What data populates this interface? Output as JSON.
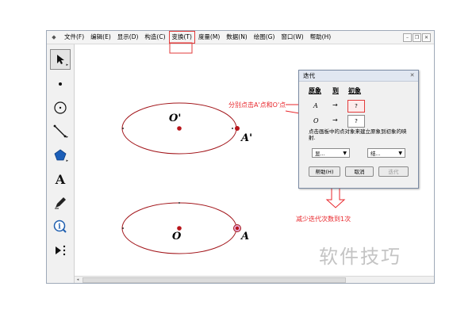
{
  "menu": {
    "items": [
      "文件(F)",
      "编辑(E)",
      "显示(D)",
      "构造(C)",
      "变换(T)",
      "度量(M)",
      "数据(N)",
      "绘图(G)",
      "窗口(W)",
      "帮助(H)"
    ],
    "highlighted_index": 4
  },
  "toolbox": {
    "tools": [
      {
        "name": "arrow-select-icon",
        "glyph": "↖"
      },
      {
        "name": "point-icon",
        "glyph": "•"
      },
      {
        "name": "compass-circle-icon",
        "glyph": "⊙"
      },
      {
        "name": "straightedge-icon",
        "glyph": "╱"
      },
      {
        "name": "polygon-icon",
        "glyph": "⬟"
      },
      {
        "name": "text-icon",
        "glyph": "A"
      },
      {
        "name": "marker-pen-icon",
        "glyph": "✎"
      },
      {
        "name": "info-icon",
        "glyph": "ⓘ"
      },
      {
        "name": "custom-tools-icon",
        "glyph": "▶⋮"
      }
    ]
  },
  "canvas": {
    "label_O_prime": "O'",
    "label_A_prime": "A'",
    "label_O": "O",
    "label_A": "A",
    "annotation_click": "分别点击A'点和O'点",
    "annotation_reduce": "减少迭代次数到1次"
  },
  "dialog": {
    "title": "迭代",
    "col_preimage": "原象",
    "col_to": "到",
    "col_image": "初象",
    "row1_point": "A",
    "row1_arrow": "→",
    "row1_value": "?",
    "row2_point": "O",
    "row2_arrow": "→",
    "row2_value": "?",
    "info_text": "点击画板中的点对象来建立原象到初象的映射.",
    "display_select": "显...",
    "structure_select": "结...",
    "btn_help": "帮助(H)",
    "btn_cancel": "取消",
    "btn_iterate": "迭代"
  },
  "watermark": "软件技巧",
  "colors": {
    "ellipse": "#a3171c",
    "point": "#b8151b",
    "annotation": "#e8262b",
    "highlight_box": "#e23b3b"
  }
}
